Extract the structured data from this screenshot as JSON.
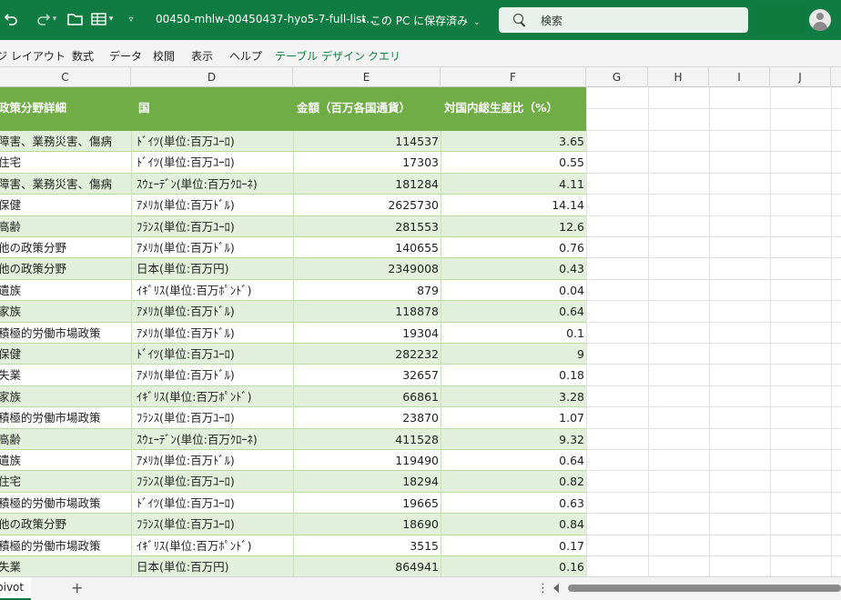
{
  "titlebar": {
    "title": "00450-mhlw-00450437-hyo5-7-full-list…",
    "save_state": "• この PC に保存済み",
    "search_placeholder": "検索",
    "icons": [
      "undo-icon",
      "redo-icon",
      "open-folder-icon",
      "table-layout-icon",
      "customize-toolbar-icon",
      "search-icon",
      "avatar-icon"
    ]
  },
  "ribbon": {
    "tabs": [
      "ジ レイアウト",
      "数式",
      "データ",
      "校閲",
      "表示",
      "ヘルプ",
      "テーブル デザイン",
      "クエリ"
    ]
  },
  "columns": [
    "C",
    "D",
    "E",
    "F",
    "G",
    "H",
    "I",
    "J"
  ],
  "table": {
    "headers": [
      "政策分野詳細",
      "国",
      "金額（百万各国通貨）",
      "対国内総生産比（%）"
    ],
    "rows": [
      [
        "障害、業務災害、傷病",
        "ﾄﾞｲﾂ(単位:百万ﾕｰﾛ)",
        "114537",
        "3.65"
      ],
      [
        "住宅",
        "ﾄﾞｲﾂ(単位:百万ﾕｰﾛ)",
        "17303",
        "0.55"
      ],
      [
        "障害、業務災害、傷病",
        "ｽｳｪｰﾃﾞﾝ(単位:百万ｸﾛｰﾈ)",
        "181284",
        "4.11"
      ],
      [
        "保健",
        "ｱﾒﾘｶ(単位:百万ﾄﾞﾙ)",
        "2625730",
        "14.14"
      ],
      [
        "高齢",
        "ﾌﾗﾝｽ(単位:百万ﾕｰﾛ)",
        "281553",
        "12.6"
      ],
      [
        "他の政策分野",
        "ｱﾒﾘｶ(単位:百万ﾄﾞﾙ)",
        "140655",
        "0.76"
      ],
      [
        "他の政策分野",
        "日本(単位:百万円)",
        "2349008",
        "0.43"
      ],
      [
        "遺族",
        "ｲｷﾞﾘｽ(単位:百万ﾎﾟﾝﾄﾞ)",
        "879",
        "0.04"
      ],
      [
        "家族",
        "ｱﾒﾘｶ(単位:百万ﾄﾞﾙ)",
        "118878",
        "0.64"
      ],
      [
        "積極的労働市場政策",
        "ｱﾒﾘｶ(単位:百万ﾄﾞﾙ)",
        "19304",
        "0.1"
      ],
      [
        "保健",
        "ﾄﾞｲﾂ(単位:百万ﾕｰﾛ)",
        "282232",
        "9"
      ],
      [
        "失業",
        "ｱﾒﾘｶ(単位:百万ﾄﾞﾙ)",
        "32657",
        "0.18"
      ],
      [
        "家族",
        "ｲｷﾞﾘｽ(単位:百万ﾎﾟﾝﾄﾞ)",
        "66861",
        "3.28"
      ],
      [
        "積極的労働市場政策",
        "ﾌﾗﾝｽ(単位:百万ﾕｰﾛ)",
        "23870",
        "1.07"
      ],
      [
        "高齢",
        "ｽｳｪｰﾃﾞﾝ(単位:百万ｸﾛｰﾈ)",
        "411528",
        "9.32"
      ],
      [
        "遺族",
        "ｱﾒﾘｶ(単位:百万ﾄﾞﾙ)",
        "119490",
        "0.64"
      ],
      [
        "住宅",
        "ﾌﾗﾝｽ(単位:百万ﾕｰﾛ)",
        "18294",
        "0.82"
      ],
      [
        "積極的労働市場政策",
        "ﾄﾞｲﾂ(単位:百万ﾕｰﾛ)",
        "19665",
        "0.63"
      ],
      [
        "他の政策分野",
        "ﾌﾗﾝｽ(単位:百万ﾕｰﾛ)",
        "18690",
        "0.84"
      ],
      [
        "積極的労働市場政策",
        "ｲｷﾞﾘｽ(単位:百万ﾎﾟﾝﾄﾞ)",
        "3515",
        "0.17"
      ],
      [
        "失業",
        "日本(単位:百万円)",
        "864941",
        "0.16"
      ]
    ]
  },
  "bottombar": {
    "sheet_tab": "pivot",
    "add_sheet": "+",
    "more": "⋮"
  },
  "colors": {
    "titlebar": "#107c41",
    "table_header": "#70ad47",
    "band": "#e2efda"
  }
}
